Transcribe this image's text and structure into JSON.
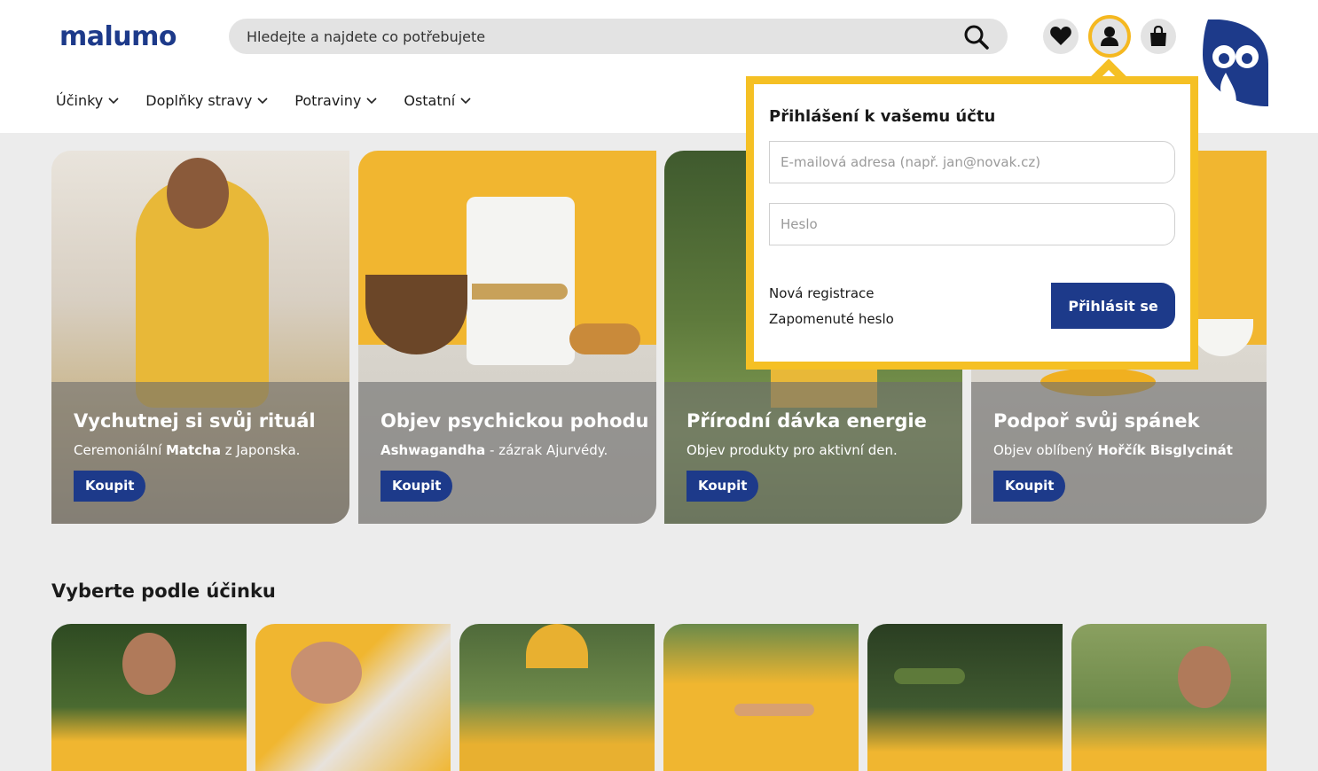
{
  "brand": {
    "logo_text": "malumo",
    "primary": "#1d3a8a",
    "accent": "#f5c024"
  },
  "search": {
    "placeholder": "Hledejte a najdete co potřebujete",
    "icon": "search-icon"
  },
  "header_icons": [
    {
      "name": "favorites",
      "icon": "heart-icon"
    },
    {
      "name": "account",
      "icon": "user-icon",
      "active": true
    },
    {
      "name": "cart",
      "icon": "shopping-bag-icon"
    }
  ],
  "nav": {
    "items": [
      {
        "label": "Účinky"
      },
      {
        "label": "Doplňky stravy"
      },
      {
        "label": "Potraviny"
      },
      {
        "label": "Ostatní"
      }
    ]
  },
  "banners": [
    {
      "title": "Vychutnej si svůj rituál",
      "text_pre": "Ceremoniální ",
      "text_bold": "Matcha",
      "text_post": " z Japonska.",
      "button": "Koupit"
    },
    {
      "title": "Objev psychickou pohodu",
      "text_pre": "",
      "text_bold": "Ashwagandha",
      "text_post": " - zázrak Ajurvédy.",
      "button": "Koupit"
    },
    {
      "title": "Přírodní dávka energie",
      "text_pre": "Objev produkty pro aktivní den.",
      "text_bold": "",
      "text_post": "",
      "button": "Koupit"
    },
    {
      "title": "Podpoř svůj spánek",
      "text_pre": "Objev oblíbený ",
      "text_bold": "Hořčík Bisglycinát",
      "text_post": "",
      "button": "Koupit"
    }
  ],
  "effects": {
    "title": "Vyberte podle účinku"
  },
  "login_popup": {
    "title": "Přihlášení k vašemu účtu",
    "email_placeholder": "E-mailová adresa (např. jan@novak.cz)",
    "password_placeholder": "Heslo",
    "register_link": "Nová registrace",
    "forgot_link": "Zapomenuté heslo",
    "submit_label": "Přihlásit se"
  }
}
